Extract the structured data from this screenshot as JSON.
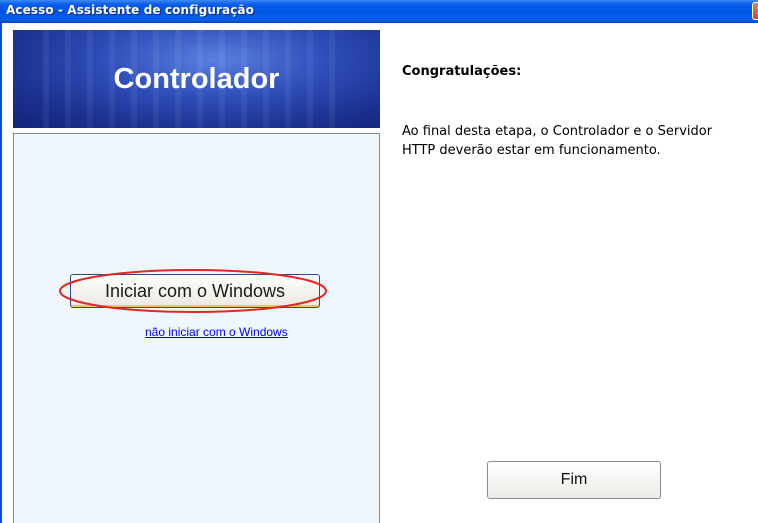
{
  "window": {
    "title": "Acesso - Assistente de configuração",
    "close_symbol": "✕"
  },
  "left": {
    "banner_title": "Controlador",
    "start_button_label": "Iniciar com o Windows",
    "no_start_link": "não iniciar com o Windows"
  },
  "right": {
    "heading": "Congratulações:",
    "description": "Ao final desta etapa, o Controlador e o Servidor HTTP deverão estar em funcionamento."
  },
  "footer": {
    "finish_label": "Fim"
  },
  "colors": {
    "titlebar": "#0054e3",
    "banner": "#1b2f8e",
    "highlight_ellipse": "#e32626",
    "panel": "#eef5fb",
    "link": "#0000ee"
  },
  "icons": {
    "close": "close-icon"
  }
}
